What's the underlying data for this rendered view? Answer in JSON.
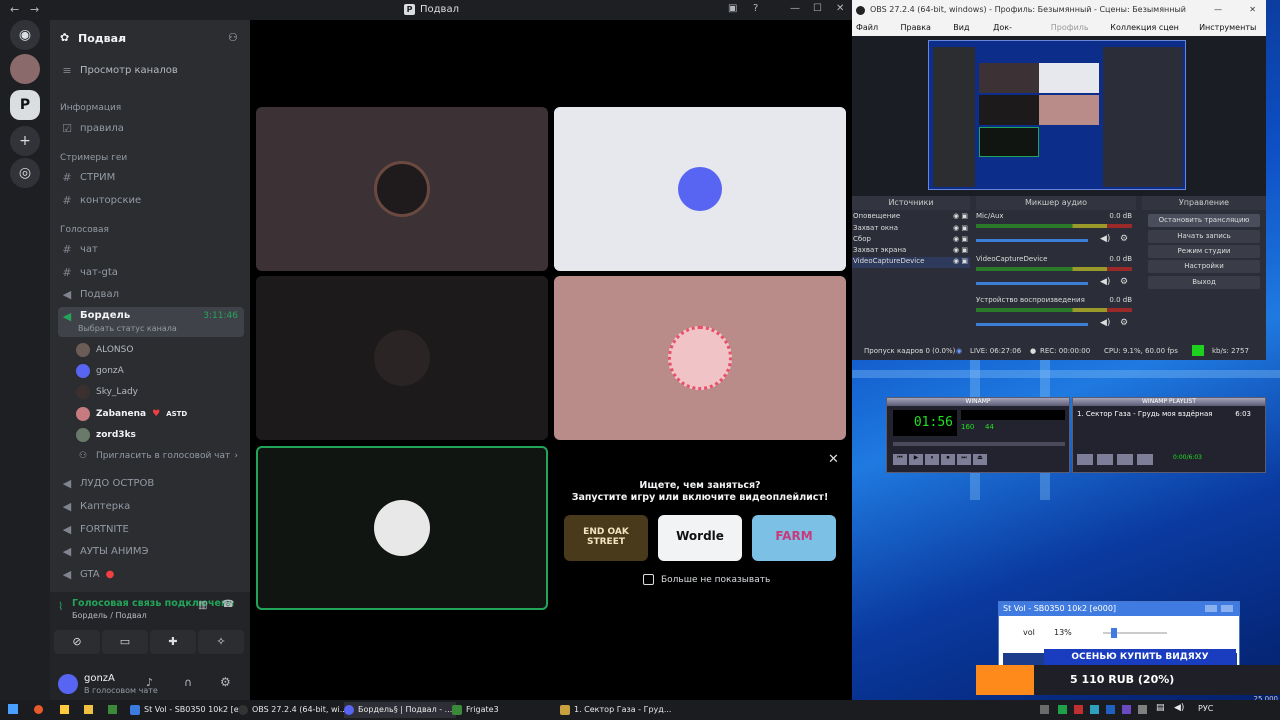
{
  "discord": {
    "window_title": "Подвал",
    "back_glyph": "←",
    "forward_glyph": "→",
    "server_name": "Подвал",
    "browse_channels": "Просмотр каналов",
    "categories": {
      "info": "Информация",
      "streamers": "Стримеры геи",
      "voice": "Голосовая"
    },
    "text_channels": [
      "правила",
      "СТРИМ",
      "конторские",
      "чат",
      "чат-gta"
    ],
    "voice_channels": [
      "Подвал",
      "Бордель",
      "ЛУДО ОСТРОВ",
      "Каптерка",
      "FORTNITE",
      "АУТЫ АНИМЭ",
      "GTA"
    ],
    "active_channel": {
      "name": "Бордель",
      "timer": "3:11:46",
      "status_prompt": "Выбрать статус канала"
    },
    "members": [
      {
        "name": "ALONSO",
        "color": "#6b5c56"
      },
      {
        "name": "gonzA",
        "color": "#5865f2"
      },
      {
        "name": "Sky_Lady",
        "color": "#3a3030"
      },
      {
        "name": "Zabanena",
        "color": "#c67b80"
      },
      {
        "name": "zord3ks",
        "color": "#6a7a6a"
      }
    ],
    "member_tag": "ASTD",
    "invite": "Пригласить в голосовой чат",
    "voice_status": "Голосовая связь подключена",
    "voice_location": "Бордель / Подвал",
    "user_name": "gonzA",
    "user_status": "В голосовом чате",
    "suggest": {
      "line1": "Ищете, чем заняться?",
      "line2": "Запустите игру или включите видеоплейлист!",
      "dont_show": "Больше не показывать",
      "games": [
        "END OAK STREET",
        "Wordle",
        "FARM"
      ]
    },
    "accent": "#23a559"
  },
  "obs": {
    "title": "OBS 27.2.4 (64-bit, windows) - Профиль: Безымянный - Сцены: Безымянный",
    "menu": [
      "Файл (F)",
      "Правка (E)",
      "Вид (V)",
      "Док-панели",
      "Профиль (P)",
      "Коллекция сцен (S)",
      "Инструменты (T)"
    ],
    "docks": {
      "sources": "Источники",
      "mixer": "Микшер аудио",
      "controls": "Управление"
    },
    "sources": [
      "Оповещение",
      "Захват окна",
      "Сбор",
      "Захват экрана",
      "VideoCaptureDevice"
    ],
    "mixer": [
      {
        "name": "Mic/Aux",
        "db": "0.0 dB"
      },
      {
        "name": "VideoCaptureDevice",
        "db": "0.0 dB"
      },
      {
        "name": "Устройство воспроизведения",
        "db": "0.0 dB"
      }
    ],
    "controls": [
      "Остановить трансляцию",
      "Начать запись",
      "Режим студии",
      "Настройки",
      "Выход"
    ],
    "status": {
      "dropped": "Пропуск кадров 0 (0.0%)",
      "live": "LIVE: 06:27:06",
      "rec": "REC: 00:00:00",
      "cpu": "CPU: 9.1%, 60.00 fps",
      "kbps": "kb/s: 2757"
    }
  },
  "winamp": {
    "title": "WINAMP",
    "time": "01:56",
    "kbps": "160",
    "khz": "44",
    "playlist_title": "WINAMP PLAYLIST",
    "track": "1. Сектор Газа - Грудь моя вздёрная",
    "track_time": "6:03",
    "pl_time": "0:00/6:03"
  },
  "volwin": {
    "title": "St Vol - SB0350 10k2 [e000]",
    "label": "vol",
    "value": "13%",
    "level": 0.13
  },
  "promo": {
    "banner": "ОСЕНЬЮ КУПИТЬ ВИДЯХУ",
    "price": "5 110 RUB (20%)",
    "total": "25 000"
  },
  "taskbar": {
    "apps": [
      "St Vol - SB0350 10k2 [e...",
      "OBS 27.2.4 (64-bit, wi...",
      "Бордель§ | Подвал - ...",
      "Frigate3",
      "1. Сектор Газа - Груд..."
    ],
    "lang": "РУС"
  }
}
